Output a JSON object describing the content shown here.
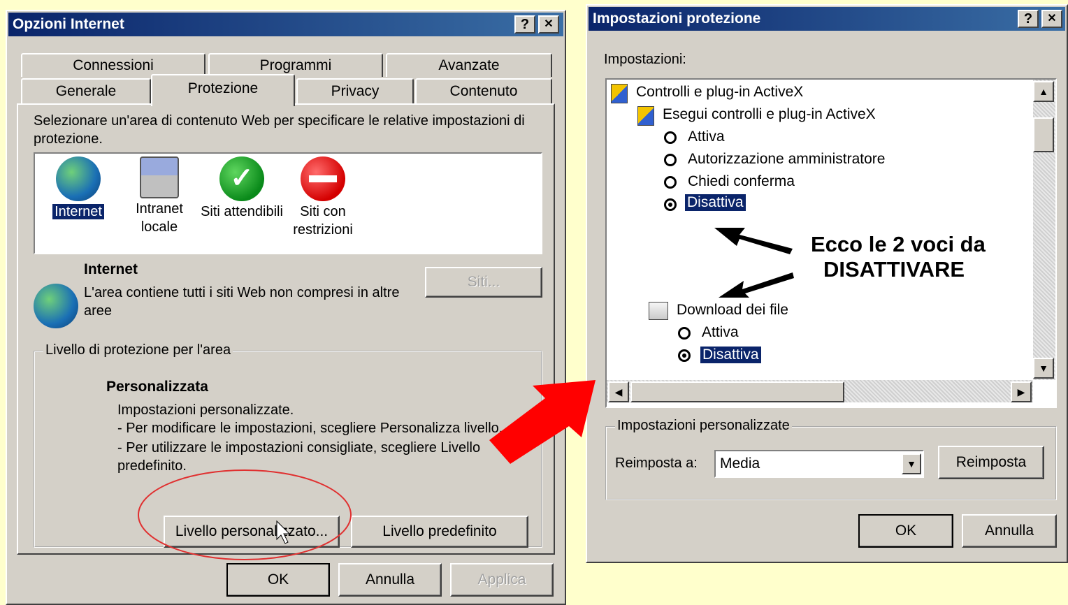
{
  "left_window": {
    "title": "Opzioni Internet",
    "help_btn": "?",
    "close_btn": "✕",
    "tabs_row1": [
      "Connessioni",
      "Programmi",
      "Avanzate"
    ],
    "tabs_row2": [
      "Generale",
      "Protezione",
      "Privacy",
      "Contenuto"
    ],
    "intro": "Selezionare un'area di contenuto Web per specificare le relative impostazioni di protezione.",
    "zones": [
      {
        "label": "Internet",
        "icon": "globe-icon"
      },
      {
        "label": "Intranet locale",
        "icon": "intranet-icon"
      },
      {
        "label": "Siti attendibili",
        "icon": "checkmark-icon"
      },
      {
        "label": "Siti con restrizioni",
        "icon": "restricted-icon"
      }
    ],
    "zone_title": "Internet",
    "zone_desc": "L'area contiene tutti i siti Web non compresi in altre aree",
    "sites_btn": "Siti...",
    "group_title": "Livello di protezione per l'area",
    "level_name": "Personalizzata",
    "level_line1": "Impostazioni personalizzate.",
    "level_line2": "- Per modificare le impostazioni, scegliere Personalizza livello.",
    "level_line3": "- Per utilizzare le impostazioni consigliate, scegliere Livello predefinito.",
    "custom_btn": "Livello personalizzato...",
    "default_btn": "Livello predefinito",
    "ok": "OK",
    "cancel": "Annulla",
    "apply": "Applica"
  },
  "right_window": {
    "title": "Impostazioni protezione",
    "help_btn": "?",
    "close_btn": "✕",
    "settings_label": "Impostazioni:",
    "tree": {
      "root": "Controlli e plug-in ActiveX",
      "node1": "Esegui controlli e plug-in ActiveX",
      "node1_options": [
        "Attiva",
        "Autorizzazione amministratore",
        "Chiedi conferma",
        "Disattiva"
      ],
      "node2": "Download dei file",
      "node2_options": [
        "Attiva",
        "Disattiva"
      ]
    },
    "annotation_line1": "Ecco le 2 voci da",
    "annotation_line2": "DISATTIVARE",
    "custom_group": "Impostazioni personalizzate",
    "reset_label": "Reimposta a:",
    "reset_value": "Media",
    "reset_btn": "Reimposta",
    "ok": "OK",
    "cancel": "Annulla"
  },
  "colors": {
    "arrow_red": "#ff0000",
    "title_blue": "#0a246a",
    "highlight_ellipse": "#e03030"
  }
}
